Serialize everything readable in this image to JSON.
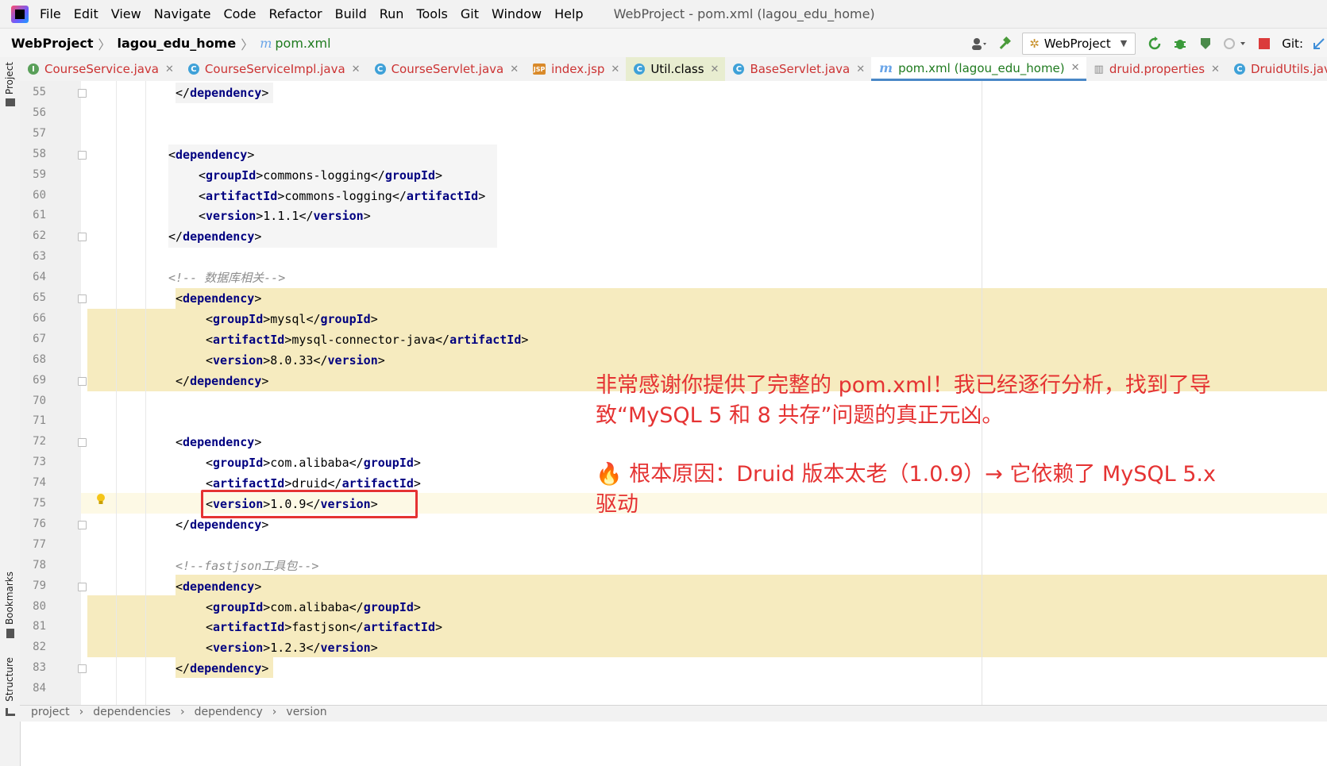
{
  "menubar": {
    "items": [
      "File",
      "Edit",
      "View",
      "Navigate",
      "Code",
      "Refactor",
      "Build",
      "Run",
      "Tools",
      "Git",
      "Window",
      "Help"
    ],
    "window_title": "WebProject - pom.xml (lagou_edu_home)"
  },
  "navbar": {
    "project": "WebProject",
    "module": "lagou_edu_home",
    "file": "pom.xml",
    "run_config": "WebProject",
    "git_label": "Git:"
  },
  "tabs": [
    {
      "label": "CourseService.java"
    },
    {
      "label": "CourseServiceImpl.java"
    },
    {
      "label": "CourseServlet.java"
    },
    {
      "label": "index.jsp"
    },
    {
      "label": "Util.class"
    },
    {
      "label": "BaseServlet.java"
    },
    {
      "label": "pom.xml (lagou_edu_home)"
    },
    {
      "label": "druid.properties"
    },
    {
      "label": "DruidUtils.java"
    }
  ],
  "side_tools": {
    "project": "Project",
    "bookmarks": "Bookmarks",
    "structure": "Structure"
  },
  "editor": {
    "line_numbers": [
      "55",
      "56",
      "57",
      "58",
      "59",
      "60",
      "61",
      "62",
      "63",
      "64",
      "65",
      "66",
      "67",
      "68",
      "69",
      "70",
      "71",
      "72",
      "73",
      "74",
      "75",
      "76",
      "77",
      "78",
      "79",
      "80",
      "81",
      "82",
      "83",
      "84"
    ],
    "lines": [
      {
        "open": "</",
        "tag": "dependency",
        "close": ">",
        "value": "",
        "tail_open": "",
        "tail_tag": "",
        "tail_close": ""
      },
      {},
      {},
      {
        "open": "<",
        "tag": "dependency",
        "close": ">"
      },
      {
        "open": "<",
        "tag": "groupId",
        "close": ">",
        "value": "commons-logging",
        "tail_open": "</",
        "tail_tag": "groupId",
        "tail_close": ">"
      },
      {
        "open": "<",
        "tag": "artifactId",
        "close": ">",
        "value": "commons-logging",
        "tail_open": "</",
        "tail_tag": "artifactId",
        "tail_close": ">"
      },
      {
        "open": "<",
        "tag": "version",
        "close": ">",
        "value": "1.1.1",
        "tail_open": "</",
        "tail_tag": "version",
        "tail_close": ">"
      },
      {
        "open": "</",
        "tag": "dependency",
        "close": ">"
      },
      {},
      {
        "comment": "<!-- 数据库相关-->"
      },
      {
        "open": "<",
        "tag": "dependency",
        "close": ">"
      },
      {
        "open": "<",
        "tag": "groupId",
        "close": ">",
        "value": "mysql",
        "tail_open": "</",
        "tail_tag": "groupId",
        "tail_close": ">"
      },
      {
        "open": "<",
        "tag": "artifactId",
        "close": ">",
        "value": "mysql-connector-java",
        "tail_open": "</",
        "tail_tag": "artifactId",
        "tail_close": ">"
      },
      {
        "open": "<",
        "tag": "version",
        "close": ">",
        "value": "8.0.33",
        "tail_open": "</",
        "tail_tag": "version",
        "tail_close": ">"
      },
      {
        "open": "</",
        "tag": "dependency",
        "close": ">"
      },
      {},
      {},
      {
        "open": "<",
        "tag": "dependency",
        "close": ">"
      },
      {
        "open": "<",
        "tag": "groupId",
        "close": ">",
        "value": "com.alibaba",
        "tail_open": "</",
        "tail_tag": "groupId",
        "tail_close": ">"
      },
      {
        "open": "<",
        "tag": "artifactId",
        "close": ">",
        "value": "druid",
        "tail_open": "</",
        "tail_tag": "artifactId",
        "tail_close": ">"
      },
      {
        "open": "<",
        "tag": "version",
        "close": ">",
        "value": "1.0.9",
        "tail_open": "</",
        "tail_tag": "version",
        "tail_close": ">"
      },
      {
        "open": "</",
        "tag": "dependency",
        "close": ">"
      },
      {},
      {
        "comment": "<!--fastjson工具包-->"
      },
      {
        "open": "<",
        "tag": "dependency",
        "close": ">"
      },
      {
        "open": "<",
        "tag": "groupId",
        "close": ">",
        "value": "com.alibaba",
        "tail_open": "</",
        "tail_tag": "groupId",
        "tail_close": ">"
      },
      {
        "open": "<",
        "tag": "artifactId",
        "close": ">",
        "value": "fastjson",
        "tail_open": "</",
        "tail_tag": "artifactId",
        "tail_close": ">"
      },
      {
        "open": "<",
        "tag": "version",
        "close": ">",
        "value": "1.2.3",
        "tail_open": "</",
        "tail_tag": "version",
        "tail_close": ">"
      },
      {
        "open": "</",
        "tag": "dependency",
        "close": ">"
      },
      {}
    ]
  },
  "annotation": {
    "line1": "非常感谢你提供了完整的 pom.xml！我已经逐行分析，找到了导",
    "line2": "致“MySQL 5 和 8 共存”问题的真正元凶。",
    "emoji": "🔥",
    "line3": "根本原因：Druid 版本太老（1.0.9）→ 它依赖了 MySQL 5.x",
    "line4": "驱动"
  },
  "breadcrumb_path": [
    "project",
    "dependencies",
    "dependency",
    "version"
  ],
  "colors": {
    "highlight": "#f6ebbf",
    "annotation_red": "#e53333",
    "tag_blue": "#000080",
    "comment_gray": "#8c8c8c"
  }
}
